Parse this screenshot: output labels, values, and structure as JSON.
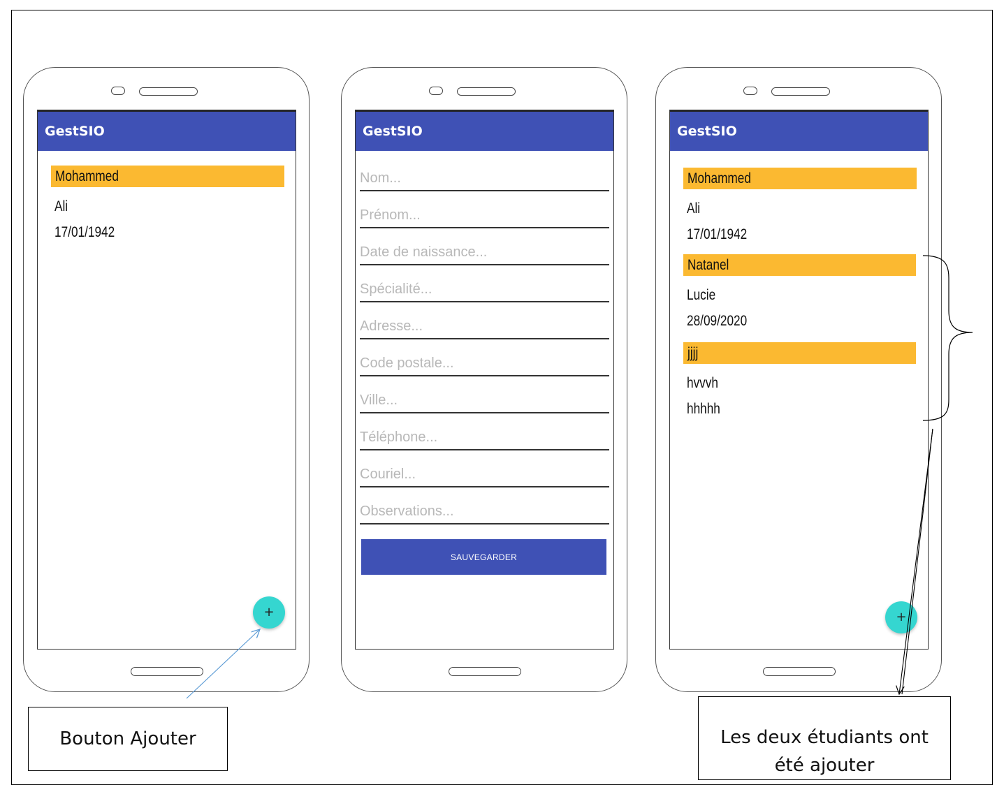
{
  "phone1": {
    "app_title": "GestSIO",
    "student": {
      "name": "Mohammed",
      "firstname": "Ali",
      "birthdate": "17/01/1942"
    },
    "fab_label": "+"
  },
  "phone2": {
    "app_title": "GestSIO",
    "fields": {
      "nom": "Nom...",
      "prenom": "Prénom...",
      "naissance": "Date de naissance...",
      "specialite": "Spécialité...",
      "adresse": "Adresse...",
      "code_postal": "Code postale...",
      "ville": "Ville...",
      "telephone": "Téléphone...",
      "courriel": "Couriel...",
      "observations": "Observations..."
    },
    "save_label": "SAUVEGARDER"
  },
  "phone3": {
    "app_title": "GestSIO",
    "students": [
      {
        "name": "Mohammed",
        "firstname": "Ali",
        "birthdate": "17/01/1942"
      },
      {
        "name": "Natanel",
        "firstname": "Lucie",
        "birthdate": "28/09/2020"
      },
      {
        "name": "jjjj",
        "firstname": "hvvvh",
        "birthdate": "hhhhh"
      }
    ],
    "fab_label": "+"
  },
  "annotations": {
    "add_button": "Bouton Ajouter",
    "added_line1": "Les deux étudiants ont",
    "added_line2": "été ajouter"
  },
  "colors": {
    "appbar": "#3f51b5",
    "name_bar": "#fbb931",
    "fab": "#35d6d0",
    "arrow_blue": "#5b9bd5"
  }
}
